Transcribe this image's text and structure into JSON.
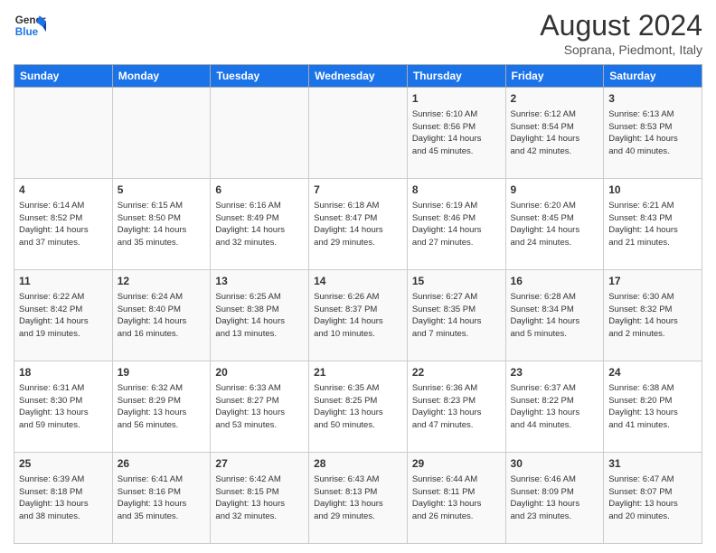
{
  "logo": {
    "line1": "General",
    "line2": "Blue"
  },
  "title": "August 2024",
  "subtitle": "Soprana, Piedmont, Italy",
  "days_of_week": [
    "Sunday",
    "Monday",
    "Tuesday",
    "Wednesday",
    "Thursday",
    "Friday",
    "Saturday"
  ],
  "weeks": [
    [
      {
        "day": "",
        "info": ""
      },
      {
        "day": "",
        "info": ""
      },
      {
        "day": "",
        "info": ""
      },
      {
        "day": "",
        "info": ""
      },
      {
        "day": "1",
        "info": "Sunrise: 6:10 AM\nSunset: 8:56 PM\nDaylight: 14 hours\nand 45 minutes."
      },
      {
        "day": "2",
        "info": "Sunrise: 6:12 AM\nSunset: 8:54 PM\nDaylight: 14 hours\nand 42 minutes."
      },
      {
        "day": "3",
        "info": "Sunrise: 6:13 AM\nSunset: 8:53 PM\nDaylight: 14 hours\nand 40 minutes."
      }
    ],
    [
      {
        "day": "4",
        "info": "Sunrise: 6:14 AM\nSunset: 8:52 PM\nDaylight: 14 hours\nand 37 minutes."
      },
      {
        "day": "5",
        "info": "Sunrise: 6:15 AM\nSunset: 8:50 PM\nDaylight: 14 hours\nand 35 minutes."
      },
      {
        "day": "6",
        "info": "Sunrise: 6:16 AM\nSunset: 8:49 PM\nDaylight: 14 hours\nand 32 minutes."
      },
      {
        "day": "7",
        "info": "Sunrise: 6:18 AM\nSunset: 8:47 PM\nDaylight: 14 hours\nand 29 minutes."
      },
      {
        "day": "8",
        "info": "Sunrise: 6:19 AM\nSunset: 8:46 PM\nDaylight: 14 hours\nand 27 minutes."
      },
      {
        "day": "9",
        "info": "Sunrise: 6:20 AM\nSunset: 8:45 PM\nDaylight: 14 hours\nand 24 minutes."
      },
      {
        "day": "10",
        "info": "Sunrise: 6:21 AM\nSunset: 8:43 PM\nDaylight: 14 hours\nand 21 minutes."
      }
    ],
    [
      {
        "day": "11",
        "info": "Sunrise: 6:22 AM\nSunset: 8:42 PM\nDaylight: 14 hours\nand 19 minutes."
      },
      {
        "day": "12",
        "info": "Sunrise: 6:24 AM\nSunset: 8:40 PM\nDaylight: 14 hours\nand 16 minutes."
      },
      {
        "day": "13",
        "info": "Sunrise: 6:25 AM\nSunset: 8:38 PM\nDaylight: 14 hours\nand 13 minutes."
      },
      {
        "day": "14",
        "info": "Sunrise: 6:26 AM\nSunset: 8:37 PM\nDaylight: 14 hours\nand 10 minutes."
      },
      {
        "day": "15",
        "info": "Sunrise: 6:27 AM\nSunset: 8:35 PM\nDaylight: 14 hours\nand 7 minutes."
      },
      {
        "day": "16",
        "info": "Sunrise: 6:28 AM\nSunset: 8:34 PM\nDaylight: 14 hours\nand 5 minutes."
      },
      {
        "day": "17",
        "info": "Sunrise: 6:30 AM\nSunset: 8:32 PM\nDaylight: 14 hours\nand 2 minutes."
      }
    ],
    [
      {
        "day": "18",
        "info": "Sunrise: 6:31 AM\nSunset: 8:30 PM\nDaylight: 13 hours\nand 59 minutes."
      },
      {
        "day": "19",
        "info": "Sunrise: 6:32 AM\nSunset: 8:29 PM\nDaylight: 13 hours\nand 56 minutes."
      },
      {
        "day": "20",
        "info": "Sunrise: 6:33 AM\nSunset: 8:27 PM\nDaylight: 13 hours\nand 53 minutes."
      },
      {
        "day": "21",
        "info": "Sunrise: 6:35 AM\nSunset: 8:25 PM\nDaylight: 13 hours\nand 50 minutes."
      },
      {
        "day": "22",
        "info": "Sunrise: 6:36 AM\nSunset: 8:23 PM\nDaylight: 13 hours\nand 47 minutes."
      },
      {
        "day": "23",
        "info": "Sunrise: 6:37 AM\nSunset: 8:22 PM\nDaylight: 13 hours\nand 44 minutes."
      },
      {
        "day": "24",
        "info": "Sunrise: 6:38 AM\nSunset: 8:20 PM\nDaylight: 13 hours\nand 41 minutes."
      }
    ],
    [
      {
        "day": "25",
        "info": "Sunrise: 6:39 AM\nSunset: 8:18 PM\nDaylight: 13 hours\nand 38 minutes."
      },
      {
        "day": "26",
        "info": "Sunrise: 6:41 AM\nSunset: 8:16 PM\nDaylight: 13 hours\nand 35 minutes."
      },
      {
        "day": "27",
        "info": "Sunrise: 6:42 AM\nSunset: 8:15 PM\nDaylight: 13 hours\nand 32 minutes."
      },
      {
        "day": "28",
        "info": "Sunrise: 6:43 AM\nSunset: 8:13 PM\nDaylight: 13 hours\nand 29 minutes."
      },
      {
        "day": "29",
        "info": "Sunrise: 6:44 AM\nSunset: 8:11 PM\nDaylight: 13 hours\nand 26 minutes."
      },
      {
        "day": "30",
        "info": "Sunrise: 6:46 AM\nSunset: 8:09 PM\nDaylight: 13 hours\nand 23 minutes."
      },
      {
        "day": "31",
        "info": "Sunrise: 6:47 AM\nSunset: 8:07 PM\nDaylight: 13 hours\nand 20 minutes."
      }
    ]
  ]
}
